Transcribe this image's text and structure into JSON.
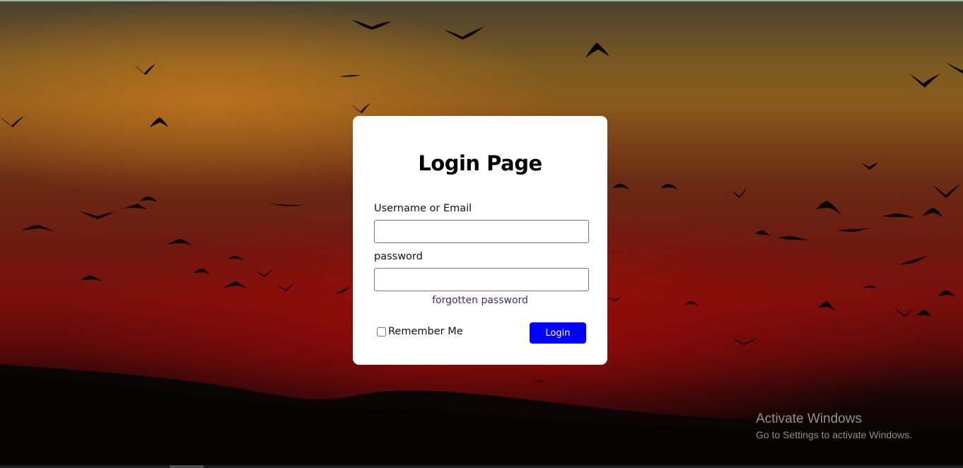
{
  "login": {
    "title": "Login Page",
    "username_label": "Username or Email",
    "username_value": "",
    "password_label": "password",
    "password_value": "",
    "forgot_link": "forgotten password",
    "remember_label": "Remember Me",
    "remember_checked": false,
    "login_button": "Login"
  },
  "watermark": {
    "title": "Activate Windows",
    "subtitle": "Go to Settings to activate Windows."
  },
  "colors": {
    "button": "#0000ff",
    "link": "#3a2a8a",
    "card": "#ffffff"
  }
}
